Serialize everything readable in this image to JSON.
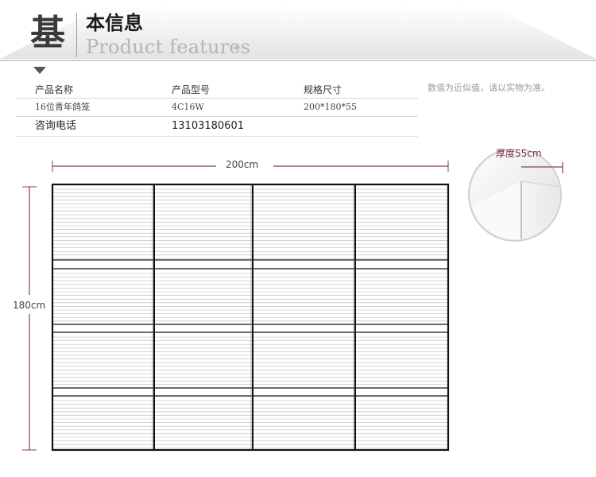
{
  "header": {
    "icon_char": "基",
    "title_cn": "本信息",
    "title_en": "Product features",
    "title_en_arrow": "▸"
  },
  "info_table": {
    "columns": [
      "产品名称",
      "产品型号",
      "规格尺寸"
    ],
    "row": [
      "16位青年鸽笼",
      "4C16W",
      "200*180*55"
    ],
    "contact_label": "咨询电话",
    "contact_value": "13103180601"
  },
  "note": "数值为近似值，请以实物为准。",
  "drawing": {
    "width_label": "200cm",
    "height_label": "180cm",
    "depth_label": "厚度55cm",
    "grid_columns": 4,
    "grid_rows": 4
  },
  "colors": {
    "dimension_line": "#8a3a5a",
    "grid_frame": "#111111",
    "slat_line": "#b8b8b8",
    "header_gradient_top": "#ffffff",
    "header_gradient_bottom": "#e2e2e2"
  }
}
